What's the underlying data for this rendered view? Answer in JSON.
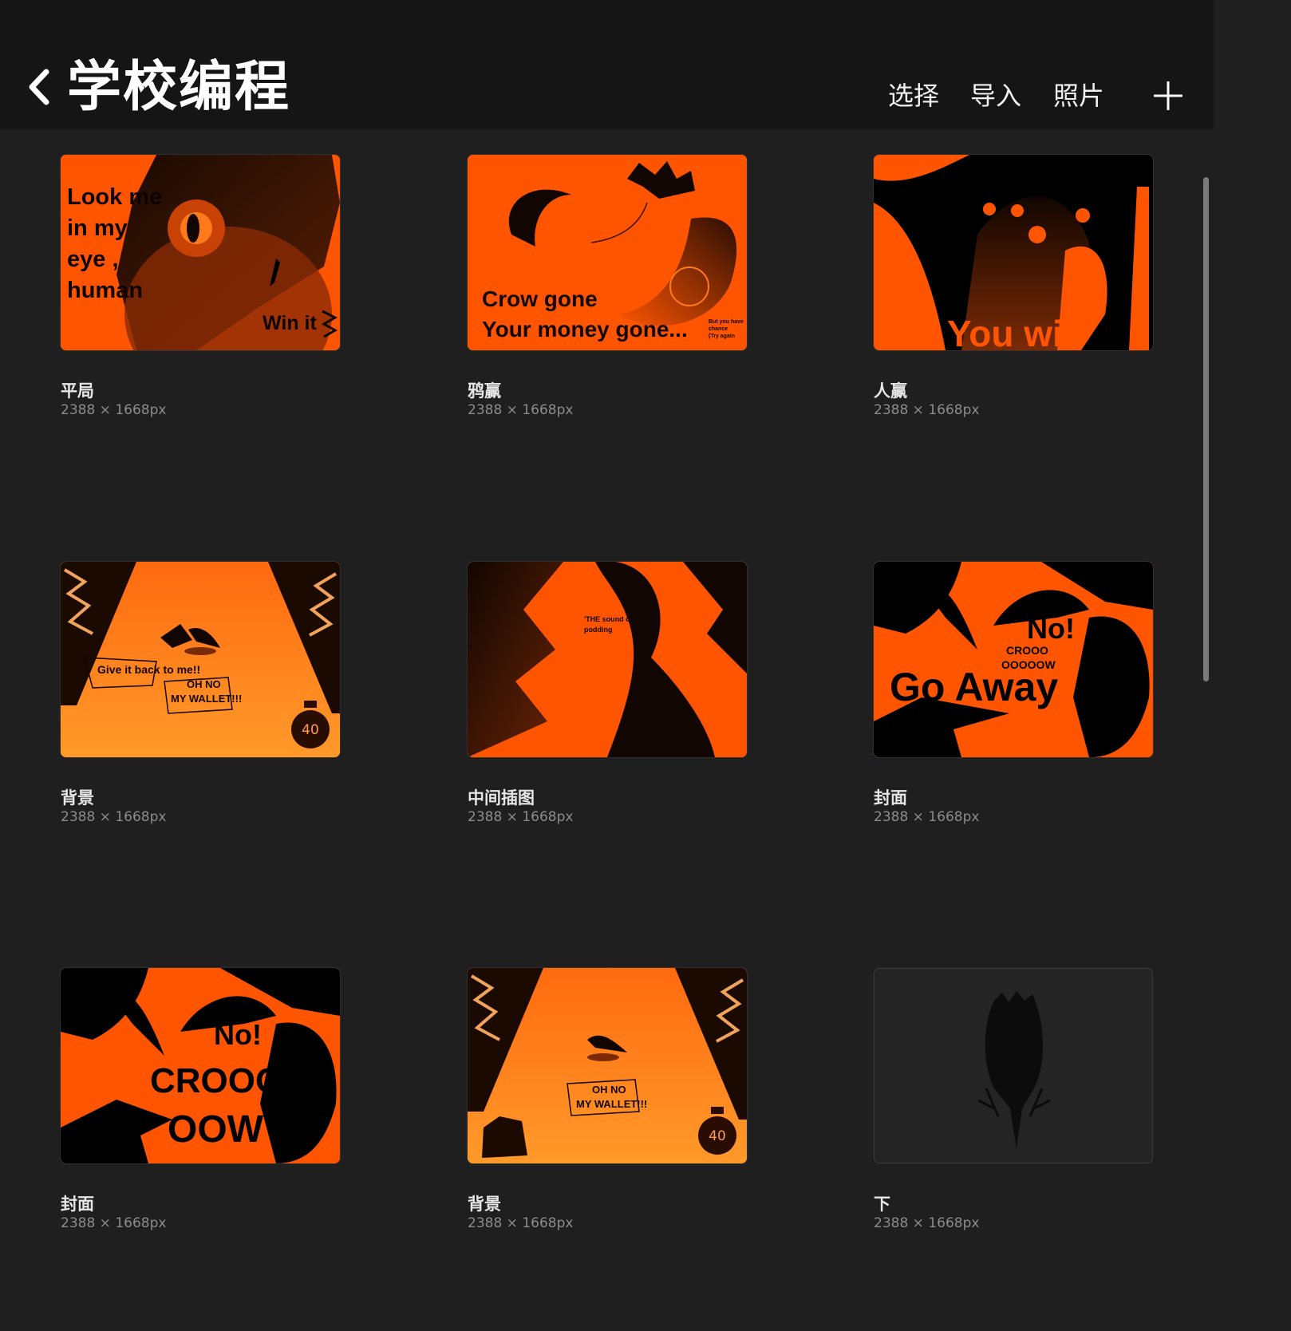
{
  "header": {
    "title": "学校编程",
    "actions": {
      "select": "选择",
      "import": "导入",
      "photos": "照片"
    }
  },
  "icons": {
    "back": "chevron-left-icon",
    "add": "plus-icon"
  },
  "colors": {
    "accent_orange": "#ff5500",
    "background": "#1f1f1f",
    "header": "#151515"
  },
  "gallery": {
    "items": [
      {
        "name": "平局",
        "dims": "2388 × 1668px",
        "art": {
          "l1": "Look me",
          "l2": "in my",
          "l3": "eye ,",
          "l4": "human",
          "l5": "Win it"
        }
      },
      {
        "name": "鸦赢",
        "dims": "2388 × 1668px",
        "art": {
          "l1": "Crow gone",
          "l2": "Your money gone...",
          "s1": "But you have",
          "s2": "chance",
          "s3": "(Try again"
        }
      },
      {
        "name": "人赢",
        "dims": "2388 × 1668px",
        "art": {
          "l1": "You win"
        }
      },
      {
        "name": "背景",
        "dims": "2388 × 1668px",
        "art": {
          "l1": "Give it back to me!!",
          "l2": "OH NO",
          "l3": "MY WALLET!!!",
          "timer": "40"
        }
      },
      {
        "name": "中间插图",
        "dims": "2388 × 1668px",
        "art": {
          "l1": "'THE sound of wings",
          "l2": "podding"
        }
      },
      {
        "name": "封面",
        "dims": "2388 × 1668px",
        "art": {
          "l1": "No!",
          "l2": "CROOO",
          "l3": "OOOOOW",
          "l4": "Go Away"
        }
      },
      {
        "name": "封面",
        "dims": "2388 × 1668px",
        "art": {
          "l1": "No!",
          "l2": "CROOO",
          "l3": "OOW"
        }
      },
      {
        "name": "背景",
        "dims": "2388 × 1668px",
        "art": {
          "l1": "OH NO",
          "l2": "MY WALLET!!!",
          "timer": "40"
        }
      },
      {
        "name": "下",
        "dims": "2388 × 1668px",
        "art": {}
      }
    ]
  }
}
